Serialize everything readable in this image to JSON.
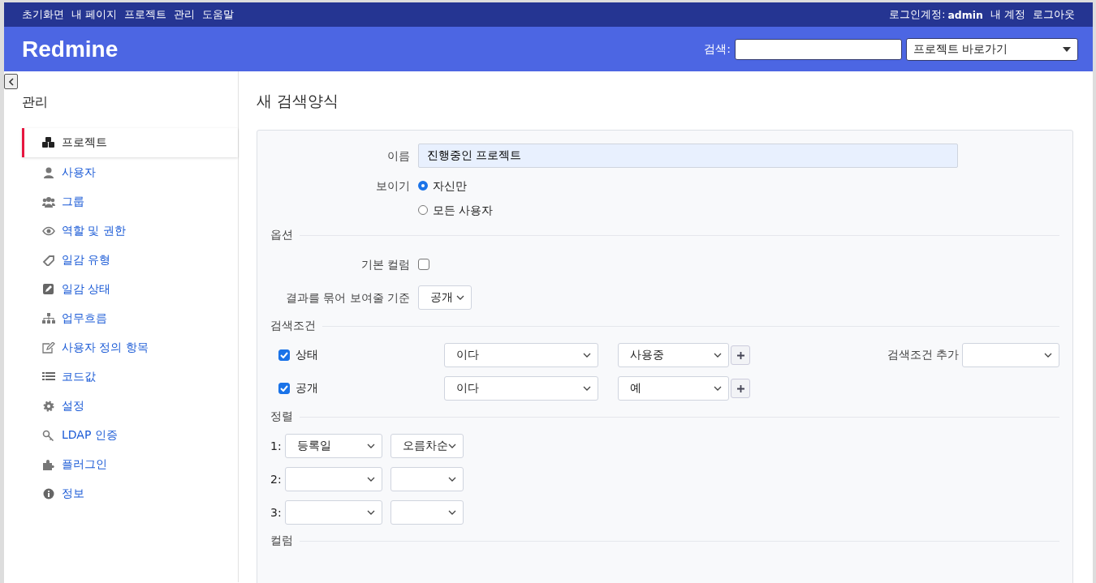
{
  "top_menu": [
    "초기화면",
    "내 페이지",
    "프로젝트",
    "관리",
    "도움말"
  ],
  "account": {
    "logged_in_label": "로그인계정:",
    "user": "admin",
    "links": [
      "내 계정",
      "로그아웃"
    ]
  },
  "header": {
    "title": "Redmine",
    "search_label": "검색:",
    "project_jump": "프로젝트 바로가기"
  },
  "sidebar": {
    "title": "관리",
    "items": [
      {
        "label": "프로젝트",
        "selected": true
      },
      {
        "label": "사용자",
        "selected": false
      },
      {
        "label": "그룹",
        "selected": false
      },
      {
        "label": "역할 및 권한",
        "selected": false
      },
      {
        "label": "일감 유형",
        "selected": false
      },
      {
        "label": "일감 상태",
        "selected": false
      },
      {
        "label": "업무흐름",
        "selected": false
      },
      {
        "label": "사용자 정의 항목",
        "selected": false
      },
      {
        "label": "코드값",
        "selected": false
      },
      {
        "label": "설정",
        "selected": false
      },
      {
        "label": "LDAP 인증",
        "selected": false
      },
      {
        "label": "플러그인",
        "selected": false
      },
      {
        "label": "정보",
        "selected": false
      }
    ]
  },
  "page_title": "새 검색양식",
  "form": {
    "name_label": "이름",
    "name_value": "진행중인 프로젝트",
    "visibility_label": "보이기",
    "visibility_options": [
      {
        "label": "자신만",
        "selected": true
      },
      {
        "label": "모든 사용자",
        "selected": false
      }
    ],
    "options_heading": "옵션",
    "default_columns_label": "기본 컬럼",
    "default_columns_checked": false,
    "group_by_label": "결과를 묶어 보여줄 기준",
    "group_by_value": "공개",
    "filters_heading": "검색조건",
    "filters": [
      {
        "label": "상태",
        "checked": true,
        "operator": "이다",
        "value": "사용중"
      },
      {
        "label": "공개",
        "checked": true,
        "operator": "이다",
        "value": "예"
      }
    ],
    "add_filter_label": "검색조건 추가",
    "sort_heading": "정렬",
    "sort": [
      {
        "index": "1:",
        "field": "등록일",
        "order": "오름차순"
      },
      {
        "index": "2:"
      },
      {
        "index": "3:"
      }
    ],
    "columns_heading": "컬럼"
  }
}
